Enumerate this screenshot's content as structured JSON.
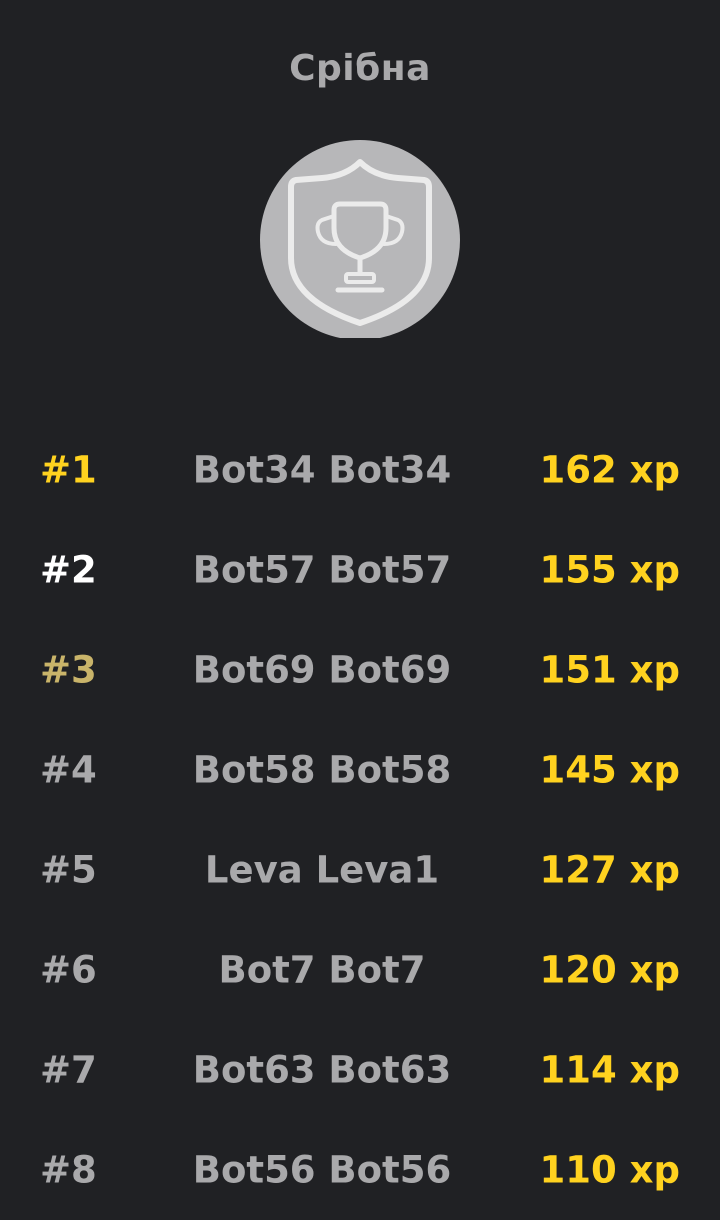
{
  "league": {
    "title": "Срібна",
    "badge_icon": "shield-trophy-icon",
    "badge_color": "#b7b7b9"
  },
  "colors": {
    "background": "#202124",
    "text_muted": "#a9a9ab",
    "xp": "#ffd21f",
    "rank_first": "#ffd21f",
    "rank_second": "#ffffff",
    "rank_third": "#c9b46a"
  },
  "leaderboard": {
    "rows": [
      {
        "rank": "#1",
        "name": "Bot34 Bot34",
        "xp": "162 xp",
        "rank_color": "#ffd21f"
      },
      {
        "rank": "#2",
        "name": "Bot57 Bot57",
        "xp": "155 xp",
        "rank_color": "#ffffff"
      },
      {
        "rank": "#3",
        "name": "Bot69 Bot69",
        "xp": "151 xp",
        "rank_color": "#c9b46a"
      },
      {
        "rank": "#4",
        "name": "Bot58 Bot58",
        "xp": "145 xp",
        "rank_color": "#a9a9ab"
      },
      {
        "rank": "#5",
        "name": "Leva Leva1",
        "xp": "127 xp",
        "rank_color": "#a9a9ab"
      },
      {
        "rank": "#6",
        "name": "Bot7 Bot7",
        "xp": "120 xp",
        "rank_color": "#a9a9ab"
      },
      {
        "rank": "#7",
        "name": "Bot63 Bot63",
        "xp": "114 xp",
        "rank_color": "#a9a9ab"
      },
      {
        "rank": "#8",
        "name": "Bot56 Bot56",
        "xp": "110 xp",
        "rank_color": "#a9a9ab"
      }
    ]
  }
}
